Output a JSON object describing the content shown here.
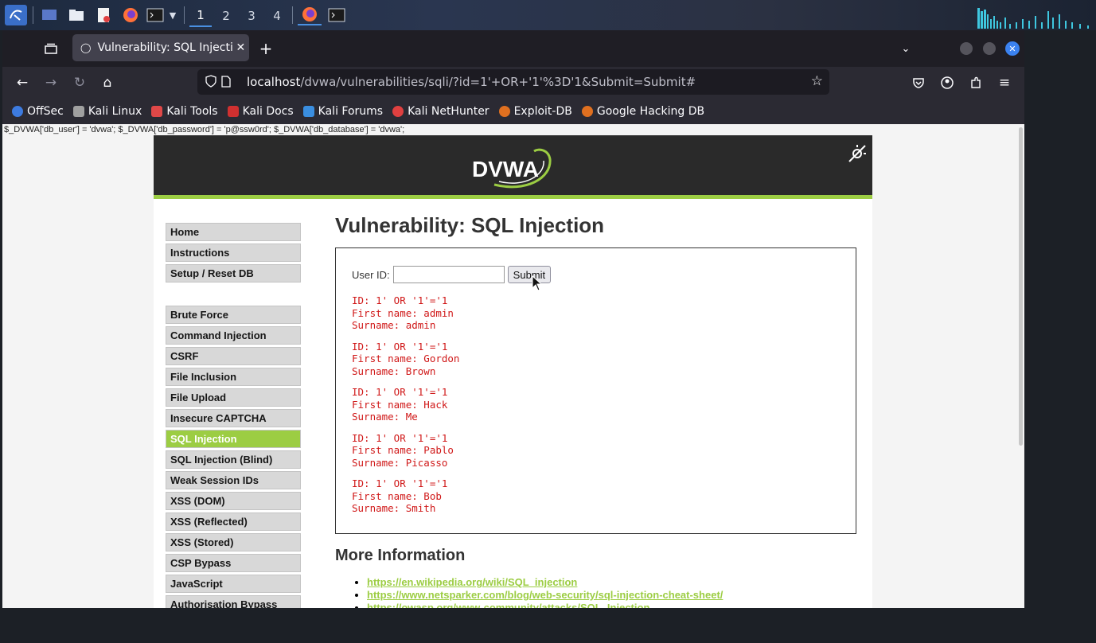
{
  "taskbar": {
    "workspaces": [
      "1",
      "2",
      "3",
      "4"
    ]
  },
  "browser": {
    "tab_title": "Vulnerability: SQL Injectio",
    "url_host": "localhost",
    "url_rest": "/dvwa/vulnerabilities/sqli/?id=1'+OR+'1'%3D'1&Submit=Submit#",
    "bookmarks": [
      {
        "label": "OffSec",
        "color": "#3d7be0"
      },
      {
        "label": "Kali Linux",
        "color": "#a0a0a0"
      },
      {
        "label": "Kali Tools",
        "color": "#e04848"
      },
      {
        "label": "Kali Docs",
        "color": "#d03030"
      },
      {
        "label": "Kali Forums",
        "color": "#3a8ee0"
      },
      {
        "label": "Kali NetHunter",
        "color": "#e04040"
      },
      {
        "label": "Exploit-DB",
        "color": "#e07020"
      },
      {
        "label": "Google Hacking DB",
        "color": "#e07020"
      }
    ]
  },
  "page": {
    "leak_text": "$_DVWA['db_user'] = 'dvwa'; $_DVWA['db_password'] = 'p@ssw0rd'; $_DVWA['db_database'] = 'dvwa';",
    "logo_text": "DVWA",
    "menu_top": [
      "Home",
      "Instructions",
      "Setup / Reset DB"
    ],
    "menu_vulns": [
      "Brute Force",
      "Command Injection",
      "CSRF",
      "File Inclusion",
      "File Upload",
      "Insecure CAPTCHA",
      "SQL Injection",
      "SQL Injection (Blind)",
      "Weak Session IDs",
      "XSS (DOM)",
      "XSS (Reflected)",
      "XSS (Stored)",
      "CSP Bypass",
      "JavaScript",
      "Authorisation Bypass"
    ],
    "selected_item": "SQL Injection",
    "title": "Vulnerability: SQL Injection",
    "form": {
      "label": "User ID:",
      "input_value": "",
      "submit_label": "Submit"
    },
    "results": [
      {
        "id": "ID: 1' OR '1'='1",
        "first": "First name: admin",
        "surname": "Surname: admin"
      },
      {
        "id": "ID: 1' OR '1'='1",
        "first": "First name: Gordon",
        "surname": "Surname: Brown"
      },
      {
        "id": "ID: 1' OR '1'='1",
        "first": "First name: Hack",
        "surname": "Surname: Me"
      },
      {
        "id": "ID: 1' OR '1'='1",
        "first": "First name: Pablo",
        "surname": "Surname: Picasso"
      },
      {
        "id": "ID: 1' OR '1'='1",
        "first": "First name: Bob",
        "surname": "Surname: Smith"
      }
    ],
    "more_title": "More Information",
    "links": [
      "https://en.wikipedia.org/wiki/SQL_injection",
      "https://www.netsparker.com/blog/web-security/sql-injection-cheat-sheet/",
      "https://owasp.org/www-community/attacks/SQL_Injection"
    ]
  },
  "colors": {
    "accent_green": "#9ccd43",
    "result_red": "#d01818",
    "header_dark": "#2a2a2a"
  }
}
